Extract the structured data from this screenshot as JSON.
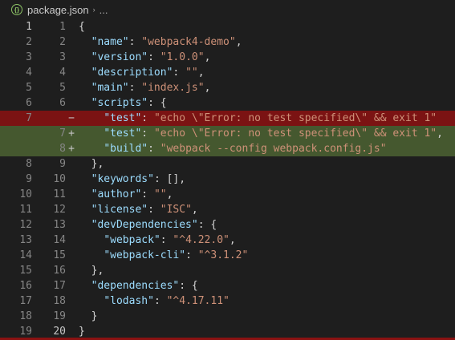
{
  "breadcrumb": {
    "icon": "json-file-icon",
    "file": "package.json",
    "separator": "›",
    "more": "..."
  },
  "colors": {
    "deleted": "#7a1010",
    "added": "#485c30",
    "key": "#9cdcfe",
    "string": "#ce9178"
  },
  "lines": [
    {
      "old": "1",
      "new": "1",
      "marker": "",
      "type": "normal",
      "text": "{"
    },
    {
      "old": "2",
      "new": "2",
      "marker": "",
      "type": "normal",
      "text": "  \"name\": \"webpack4-demo\","
    },
    {
      "old": "3",
      "new": "3",
      "marker": "",
      "type": "normal",
      "text": "  \"version\": \"1.0.0\","
    },
    {
      "old": "4",
      "new": "4",
      "marker": "",
      "type": "normal",
      "text": "  \"description\": \"\","
    },
    {
      "old": "5",
      "new": "5",
      "marker": "",
      "type": "normal",
      "text": "  \"main\": \"index.js\","
    },
    {
      "old": "6",
      "new": "6",
      "marker": "",
      "type": "normal",
      "text": "  \"scripts\": {"
    },
    {
      "old": "7",
      "new": "",
      "marker": "−",
      "type": "del",
      "text": "    \"test\": \"echo \\\"Error: no test specified\\\" && exit 1\""
    },
    {
      "old": "",
      "new": "7",
      "marker": "+",
      "type": "add",
      "text": "    \"test\": \"echo \\\"Error: no test specified\\\" && exit 1\","
    },
    {
      "old": "",
      "new": "8",
      "marker": "+",
      "type": "add",
      "text": "    \"build\": \"webpack --config webpack.config.js\""
    },
    {
      "old": "8",
      "new": "9",
      "marker": "",
      "type": "normal",
      "text": "  },"
    },
    {
      "old": "9",
      "new": "10",
      "marker": "",
      "type": "normal",
      "text": "  \"keywords\": [],"
    },
    {
      "old": "10",
      "new": "11",
      "marker": "",
      "type": "normal",
      "text": "  \"author\": \"\","
    },
    {
      "old": "11",
      "new": "12",
      "marker": "",
      "type": "normal",
      "text": "  \"license\": \"ISC\","
    },
    {
      "old": "12",
      "new": "13",
      "marker": "",
      "type": "normal",
      "text": "  \"devDependencies\": {"
    },
    {
      "old": "13",
      "new": "14",
      "marker": "",
      "type": "normal",
      "text": "    \"webpack\": \"^4.22.0\","
    },
    {
      "old": "14",
      "new": "15",
      "marker": "",
      "type": "normal",
      "text": "    \"webpack-cli\": \"^3.1.2\""
    },
    {
      "old": "15",
      "new": "16",
      "marker": "",
      "type": "normal",
      "text": "  },"
    },
    {
      "old": "16",
      "new": "17",
      "marker": "",
      "type": "normal",
      "text": "  \"dependencies\": {"
    },
    {
      "old": "17",
      "new": "18",
      "marker": "",
      "type": "normal",
      "text": "    \"lodash\": \"^4.17.11\""
    },
    {
      "old": "18",
      "new": "19",
      "marker": "",
      "type": "normal",
      "text": "  }"
    },
    {
      "old": "19",
      "new": "20",
      "marker": "",
      "type": "normal",
      "text": "}"
    }
  ]
}
